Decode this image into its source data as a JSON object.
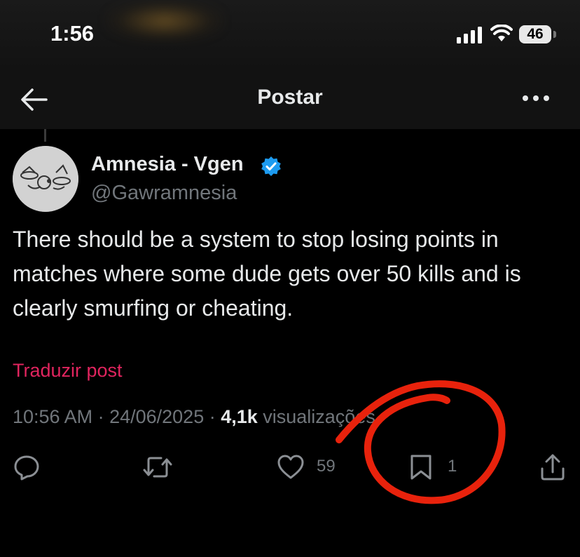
{
  "status_bar": {
    "time": "1:56",
    "battery": "46"
  },
  "header": {
    "title": "Postar"
  },
  "post": {
    "display_name": "Amnesia - Vgen",
    "handle": "@Gawramnesia",
    "text": "There should be a system to stop losing points in matches where some dude gets over 50 kills and is clearly smurfing or cheating.",
    "translate_label": "Traduzir post",
    "timestamp": "10:56 AM · 24/06/2025 · ",
    "views_count": "4,1k",
    "views_label": " visualizações"
  },
  "actions": {
    "reply_icon": "reply-icon",
    "repost_icon": "repost-icon",
    "like_icon": "heart-icon",
    "like_count": "59",
    "bookmark_icon": "bookmark-icon",
    "bookmark_count": "1",
    "share_icon": "share-icon"
  },
  "colors": {
    "background": "#000000",
    "accent_link": "#e0245e",
    "verified": "#1d9bf0",
    "annotation": "#e8220c"
  }
}
